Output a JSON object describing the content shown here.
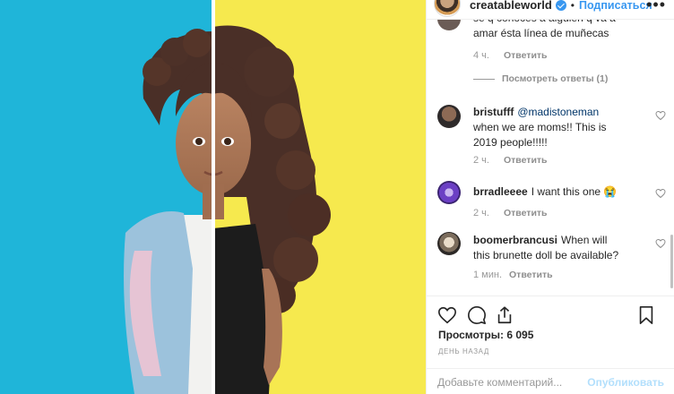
{
  "post": {
    "username": "creatableworld",
    "follow_label": "Подписаться",
    "more_label": "•••",
    "separator": "•"
  },
  "comments": [
    {
      "username": "",
      "text": "se q conoces a alguien q va a amar ésta línea de muñecas",
      "time": "4 ч.",
      "reply_label": "Ответить",
      "view_replies": "Посмотреть ответы (1)"
    },
    {
      "username": "bristufff",
      "mention": "@madistoneman",
      "text": " when we are moms!! This is 2019 people!!!!!",
      "time": "2 ч.",
      "reply_label": "Ответить"
    },
    {
      "username": "brradleeee",
      "text": "I want this one 😭",
      "time": "2 ч.",
      "reply_label": "Ответить"
    },
    {
      "username": "boomerbrancusi",
      "text": "When will this brunette doll be available?",
      "time": "1 мин.",
      "reply_label": "Ответить"
    }
  ],
  "stats": {
    "views": "Просмотры: 6 095",
    "date": "ДЕНЬ НАЗАД"
  },
  "comment_box": {
    "placeholder": "Добавьте комментарий...",
    "publish_label": "Опубликовать"
  },
  "colors": {
    "photo_left_bg": "#1fb5d9",
    "photo_right_bg": "#f6e94e",
    "link_blue": "#3897f0"
  },
  "icons": [
    "more-options-icon",
    "verified-badge-icon",
    "heart-icon",
    "comment-icon",
    "share-icon",
    "bookmark-icon"
  ]
}
